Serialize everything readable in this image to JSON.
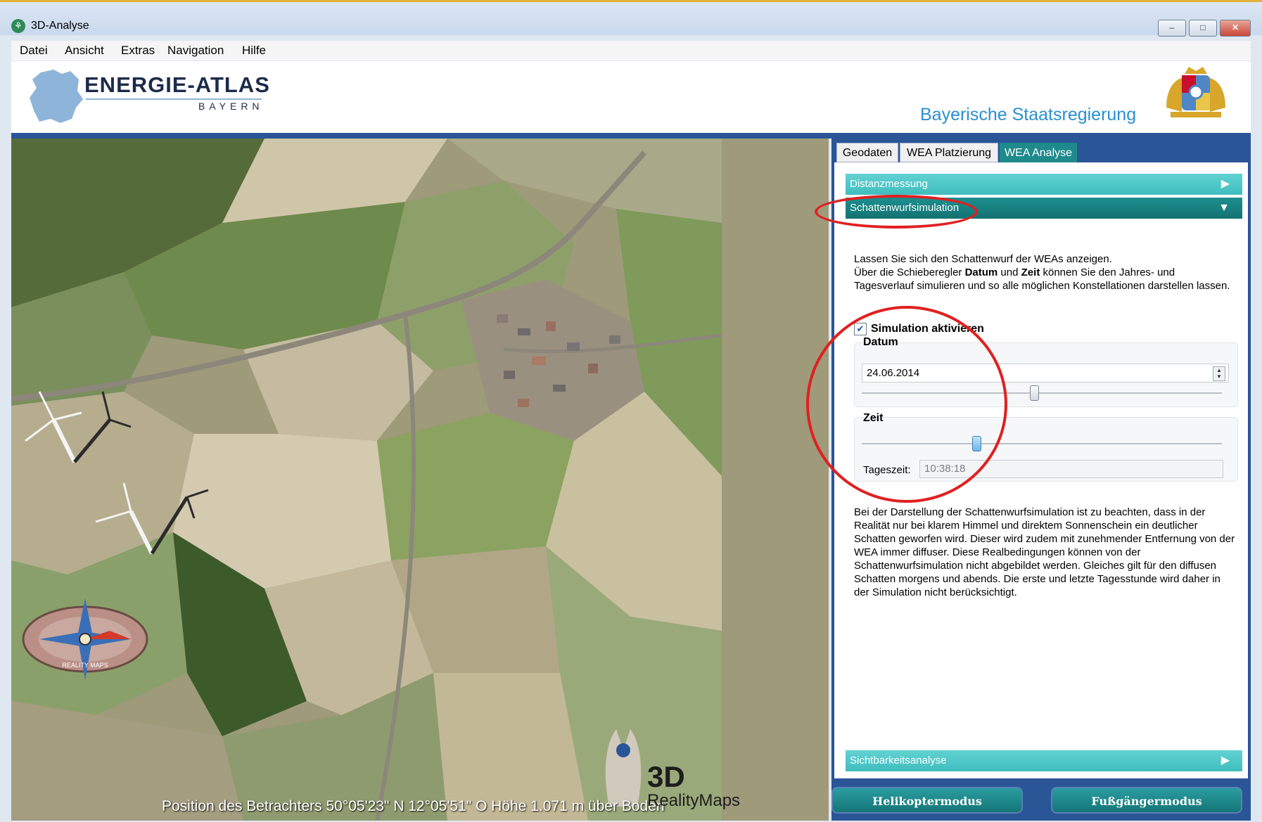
{
  "window": {
    "title": "3D-Analyse",
    "minimize_symbol": "–",
    "maximize_symbol": "□",
    "close_symbol": "✕"
  },
  "menu": [
    "Datei",
    "Ansicht",
    "Extras",
    "Navigation",
    "Hilfe"
  ],
  "banner": {
    "logo_title": "ENERGIE-ATLAS",
    "logo_subtitle": "BAYERN",
    "staatsregierung": "Bayerische Staatsregierung"
  },
  "tabs": [
    {
      "label": "Geodaten"
    },
    {
      "label": "WEA Platzierung"
    },
    {
      "label": "WEA Analyse"
    }
  ],
  "accordion": {
    "distanzmessung": "Distanzmessung",
    "schattenwurf": "Schattenwurfsimulation",
    "sichtbarkeit": "Sichtbarkeitsanalyse"
  },
  "schatten": {
    "intro_1": "Lassen Sie sich den Schattenwurf der WEAs anzeigen.",
    "intro_2a": "Über die Schieberegler ",
    "intro_datum": "Datum",
    "intro_2b": " und ",
    "intro_zeit": "Zeit",
    "intro_2c": " können Sie den Jahres- und Tagesverlauf simulieren und so alle möglichen Konstellationen darstellen lassen.",
    "simulation_label": "Simulation aktivieren",
    "simulation_checked": true,
    "datum_title": "Datum",
    "datum_value": "24.06.2014",
    "datum_slider_fraction": 0.48,
    "zeit_title": "Zeit",
    "zeit_slider_fraction": 0.32,
    "tageszeit_label": "Tageszeit:",
    "tageszeit_value": "10:38:18",
    "note": "Bei der Darstellung der Schattenwurfsimulation ist zu beachten, dass in der Realität nur bei klarem Himmel und direktem Sonnenschein ein deutlicher Schatten geworfen wird. Dieser wird zudem mit zunehmender Entfernung von der WEA immer diffuser. Diese Realbedingungen können von der Schattenwurfsimulation nicht abgebildet werden. Gleiches gilt für den diffusen Schatten morgens und abends. Die erste und letzte Tagesstunde wird daher in der Simulation nicht berücksichtigt."
  },
  "buttons": {
    "helikopter": "Helikoptermodus",
    "fussgaenger": "Fußgängermodus"
  },
  "map": {
    "position_text": "Position des Betrachters 50°05'23\" N 12°05'51\" O Höhe 1.071 m über Boden",
    "compass_label": "REALITY MAPS",
    "brand_3d": "3D",
    "brand_name": "RealityMaps"
  },
  "colors": {
    "accent_teal": "#1f8a8c",
    "frame_blue": "#2a5597",
    "annotation_red": "#e02020"
  }
}
